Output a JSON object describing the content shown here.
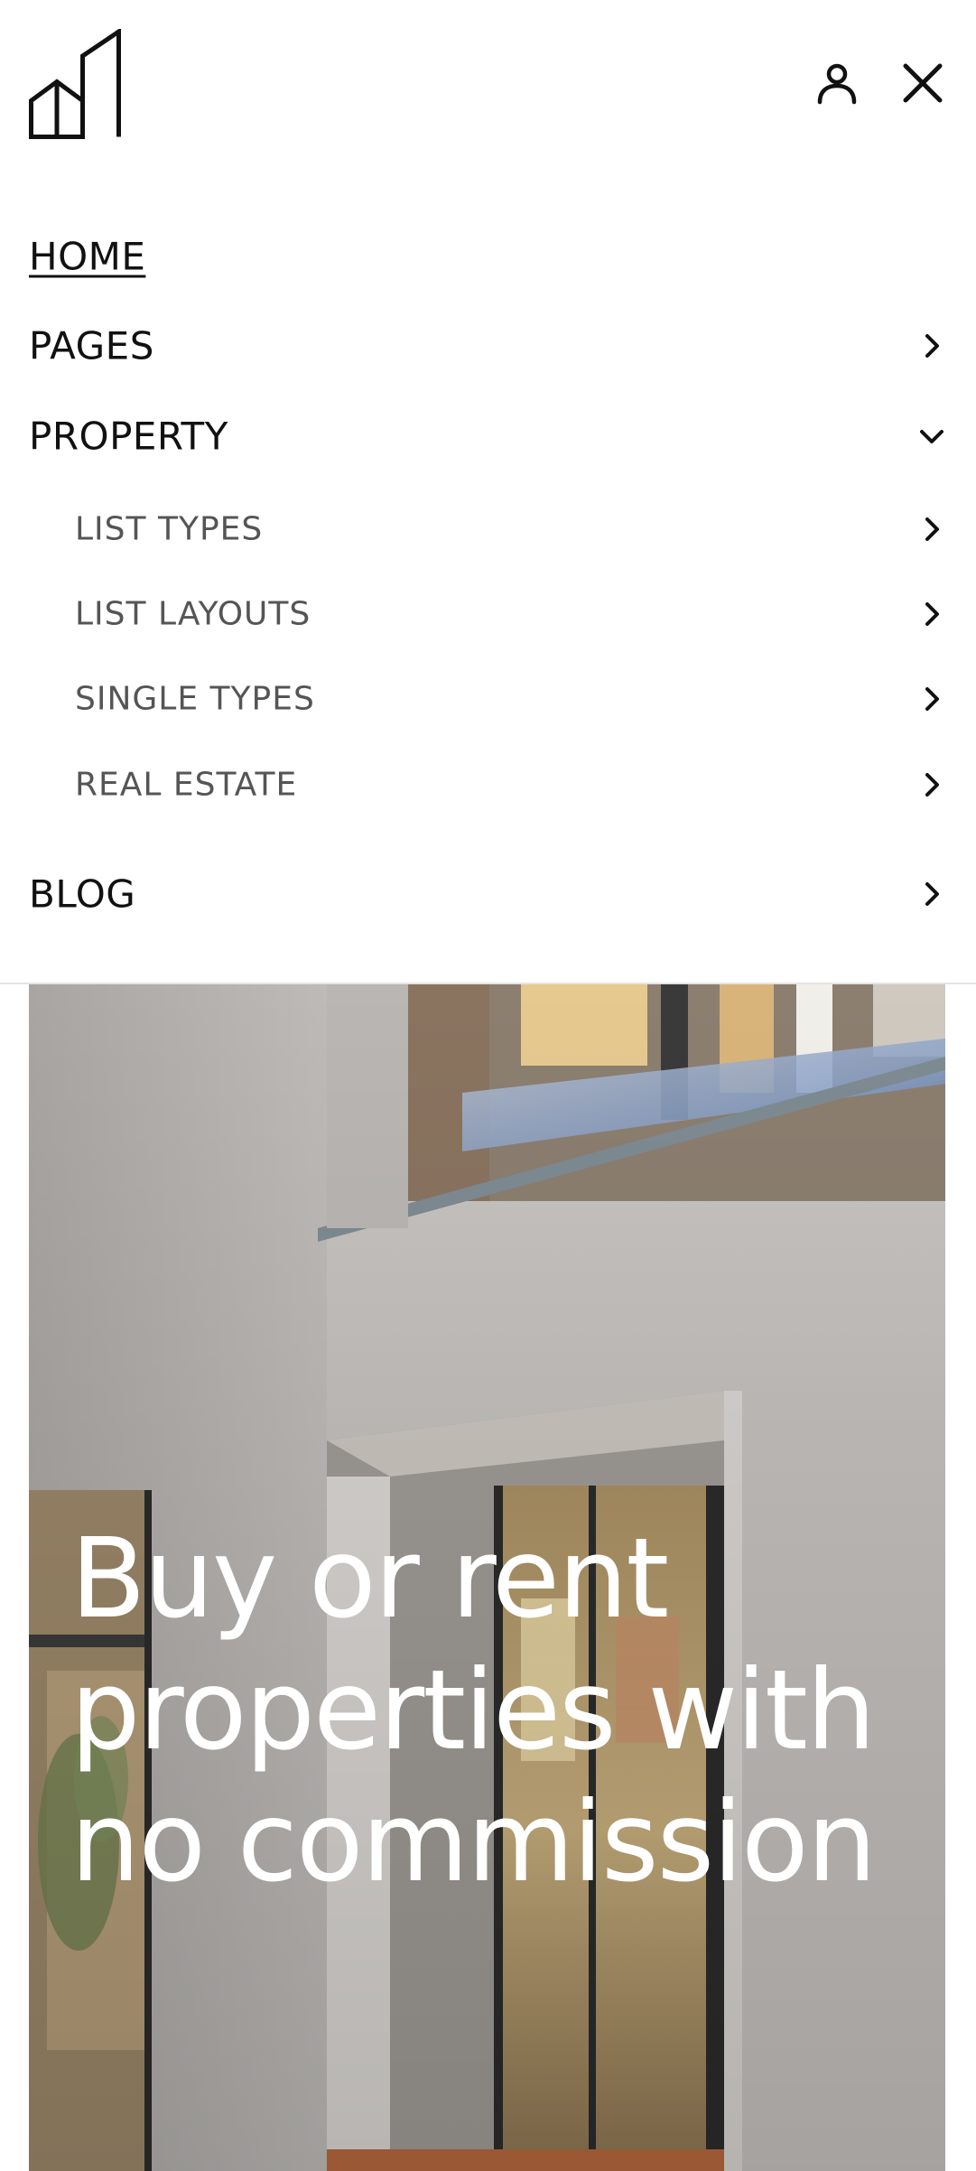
{
  "header": {
    "logo_icon": "building-logo-icon",
    "account_icon": "user-icon",
    "close_icon": "close-icon"
  },
  "menu": {
    "items": [
      {
        "label": "HOME",
        "active": true,
        "icon": null
      },
      {
        "label": "PAGES",
        "icon": "chevron-right-icon"
      },
      {
        "label": "PROPERTY",
        "icon": "chevron-down-icon",
        "expanded": true,
        "children": [
          {
            "label": "LIST TYPES",
            "icon": "chevron-right-icon"
          },
          {
            "label": "LIST LAYOUTS",
            "icon": "chevron-right-icon"
          },
          {
            "label": "SINGLE TYPES",
            "icon": "chevron-right-icon"
          },
          {
            "label": "REAL ESTATE",
            "icon": "chevron-right-icon"
          }
        ]
      },
      {
        "label": "BLOG",
        "icon": "chevron-right-icon"
      }
    ]
  },
  "hero": {
    "headline": "Buy or rent properties with no commission",
    "image": "modern-house-facade-image"
  },
  "colors": {
    "text": "#111111",
    "submenu_text": "#555555",
    "hero_text": "#ffffff",
    "divider": "#e4e4e4"
  }
}
